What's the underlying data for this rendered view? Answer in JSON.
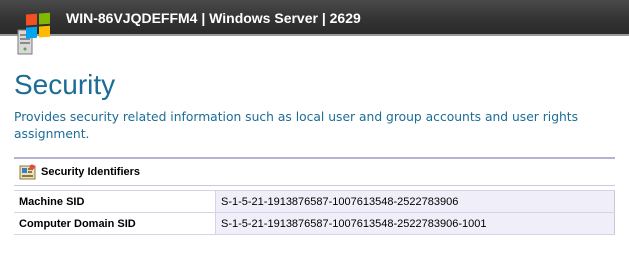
{
  "header": {
    "title": "WIN-86VJQDEFFM4 | Windows Server | 2629",
    "icon": "windows-server-icon"
  },
  "page": {
    "title": "Security",
    "description": "Provides security related information such as local user and group accounts and user rights assignment."
  },
  "section": {
    "icon": "security-identifiers-icon",
    "title": "Security Identifiers",
    "rows": [
      {
        "label": "Machine SID",
        "value": "S-1-5-21-1913876587-1007613548-2522783906"
      },
      {
        "label": "Computer Domain SID",
        "value": "S-1-5-21-1913876587-1007613548-2522783906-1001"
      }
    ]
  },
  "colors": {
    "accent": "#1c6d96",
    "header_bg": "#363636",
    "table_border": "#b5b2d6",
    "value_bg": "#f0eff9"
  }
}
